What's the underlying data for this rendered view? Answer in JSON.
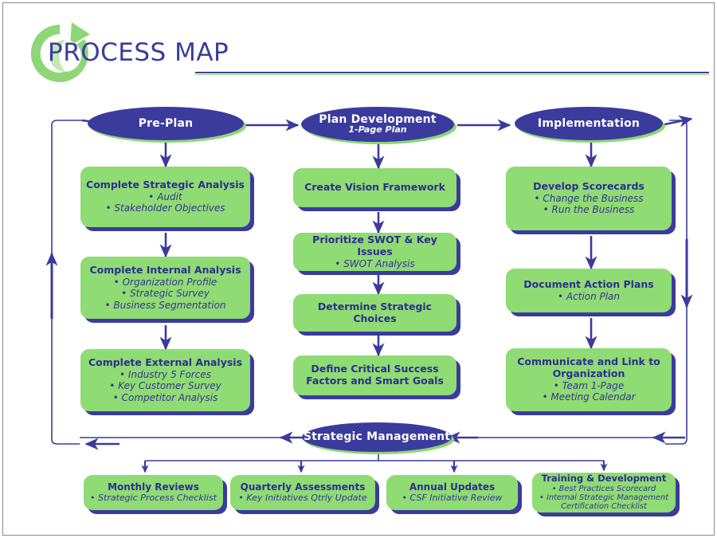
{
  "header": {
    "title": "PROCESS  MAP",
    "logo_icon": "circular-arrow-logo"
  },
  "colors": {
    "blue": "#3b3b9e",
    "green": "#8fdb74",
    "green_shadow": "#8fd676",
    "text_blue": "#2e2e8f",
    "white": "#ffffff"
  },
  "phases": [
    {
      "id": "pre-plan",
      "title": "Pre-Plan",
      "subtitle": ""
    },
    {
      "id": "plan-development",
      "title": "Plan Development",
      "subtitle": "1-Page Plan"
    },
    {
      "id": "implementation",
      "title": "Implementation",
      "subtitle": ""
    }
  ],
  "governance": {
    "id": "strategic-management",
    "title": "Strategic Management"
  },
  "columns": [
    {
      "id": "pre-plan-column",
      "steps": [
        {
          "id": "complete-strategic-analysis",
          "title": "Complete Strategic Analysis",
          "items": [
            "Audit",
            "Stakeholder Objectives"
          ]
        },
        {
          "id": "complete-internal-analysis",
          "title": "Complete Internal Analysis",
          "items": [
            "Organization Profile",
            "Strategic Survey",
            "Business Segmentation"
          ]
        },
        {
          "id": "complete-external-analysis",
          "title": "Complete External Analysis",
          "items": [
            "Industry 5 Forces",
            "Key Customer Survey",
            "Competitor Analysis"
          ]
        }
      ]
    },
    {
      "id": "plan-development-column",
      "steps": [
        {
          "id": "create-vision-framework",
          "title": "Create Vision Framework",
          "items": []
        },
        {
          "id": "prioritize-swot-key-issues",
          "title": "Prioritize SWOT & Key Issues",
          "items": [
            "SWOT Analysis"
          ]
        },
        {
          "id": "determine-strategic-choices",
          "title": "Determine Strategic Choices",
          "items": []
        },
        {
          "id": "define-critical-success-factors",
          "title": "Define Critical Success Factors and Smart Goals",
          "items": []
        }
      ]
    },
    {
      "id": "implementation-column",
      "steps": [
        {
          "id": "develop-scorecards",
          "title": "Develop Scorecards",
          "items": [
            "Change the Business",
            "Run the Business"
          ]
        },
        {
          "id": "document-action-plans",
          "title": "Document Action Plans",
          "items": [
            "Action Plan"
          ]
        },
        {
          "id": "communicate-and-link-to-organization",
          "title": "Communicate and Link to Organization",
          "items": [
            "Team 1-Page",
            "Meeting Calendar"
          ]
        }
      ]
    }
  ],
  "review_cycle": [
    {
      "id": "monthly-reviews",
      "title": "Monthly Reviews",
      "items": [
        "Strategic Process Checklist"
      ]
    },
    {
      "id": "quarterly-assessments",
      "title": "Quarterly Assessments",
      "items": [
        "Key Initiatives Qtrly Update"
      ]
    },
    {
      "id": "annual-updates",
      "title": "Annual Updates",
      "items": [
        "CSF Initiative Review"
      ]
    },
    {
      "id": "training-and-development",
      "title": "Training & Development",
      "items": [
        "Best Practices Scorecard",
        "Internal Strategic Management Certification Checklist"
      ]
    }
  ]
}
